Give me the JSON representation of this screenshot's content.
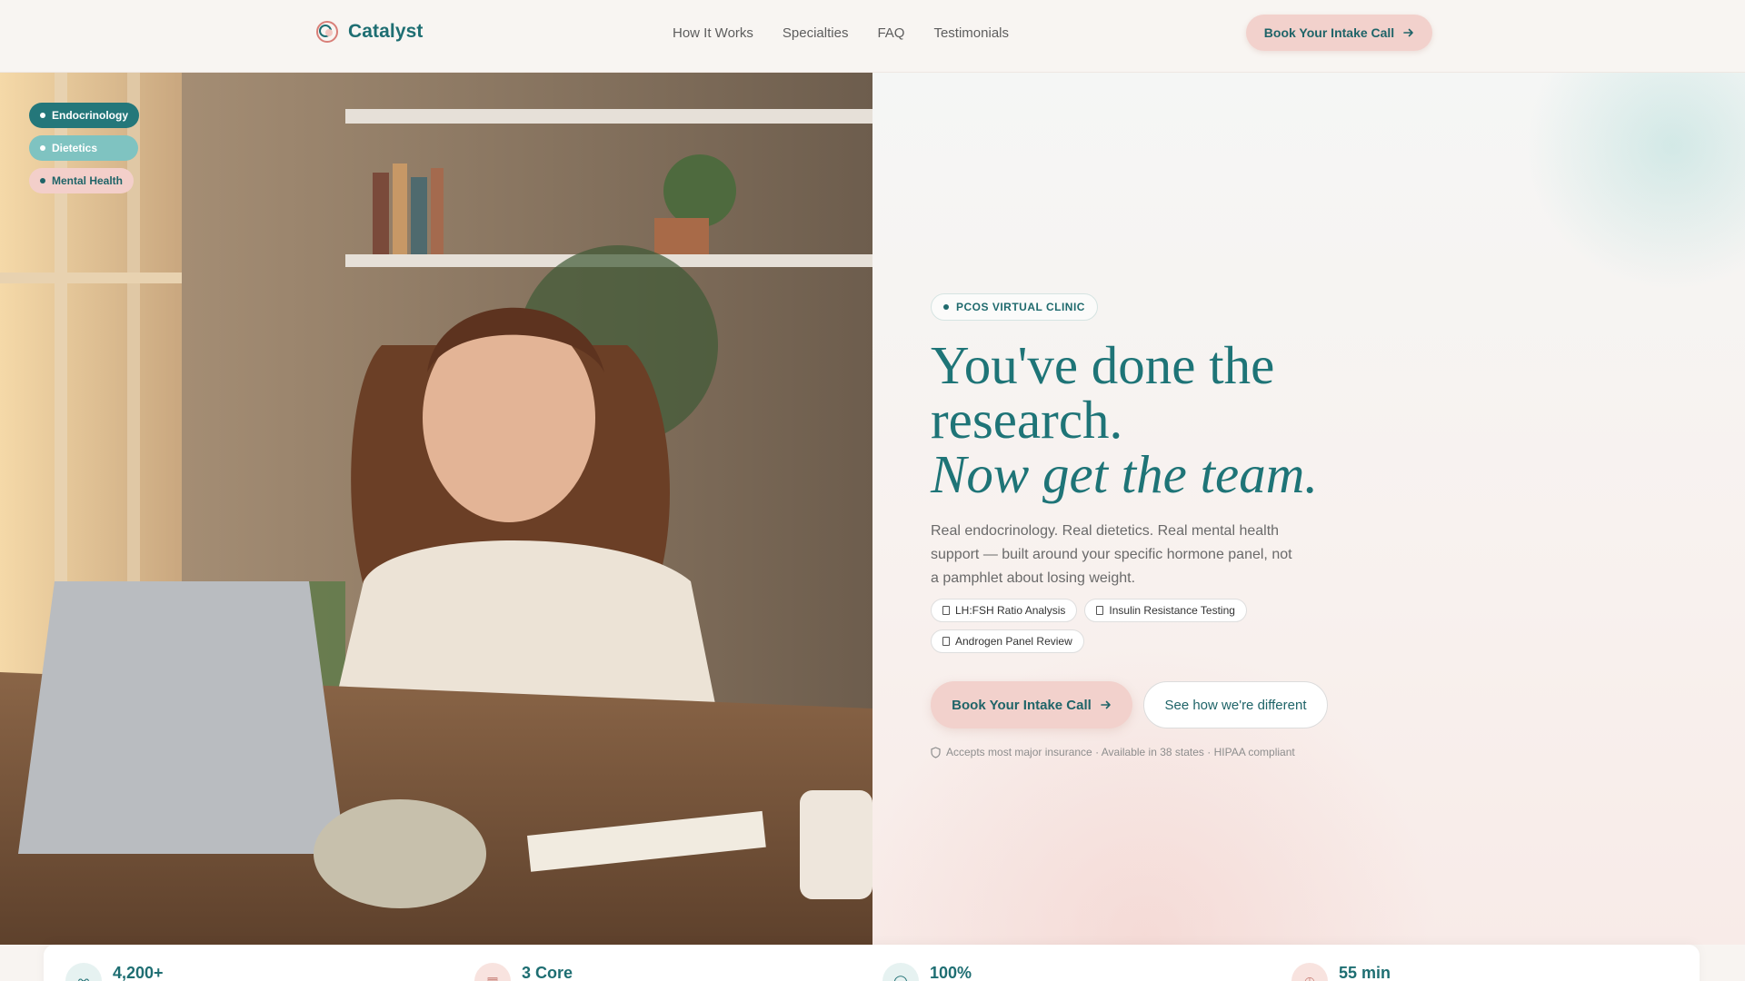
{
  "nav": {
    "brand": "Catalyst",
    "links": [
      "How It Works",
      "Specialties",
      "FAQ",
      "Testimonials"
    ],
    "cta_label": "Book Your Intake Call"
  },
  "hero_chips": [
    {
      "label": "Endocrinology"
    },
    {
      "label": "Dietetics"
    },
    {
      "label": "Mental Health"
    }
  ],
  "hero": {
    "eyebrow": "PCOS VIRTUAL CLINIC",
    "headline_line1": "You've done the",
    "headline_line2": "research.",
    "headline_italic": "Now get the team.",
    "lede": "Real endocrinology. Real dietetics. Real mental health support — built around your specific hormone panel, not a pamphlet about losing weight.",
    "tags": [
      "LH:FSH Ratio Analysis",
      "Insulin Resistance Testing",
      "Androgen Panel Review"
    ],
    "primary_cta": "Book Your Intake Call",
    "secondary_cta": "See how we're different",
    "trust_line": "Accepts most major insurance · Available in 38 states · HIPAA compliant"
  },
  "stats": [
    {
      "value": "4,200+",
      "icon": "people-icon"
    },
    {
      "value": "3 Core",
      "icon": "calendar-icon"
    },
    {
      "value": "100%",
      "icon": "shield-icon"
    },
    {
      "value": "55 min",
      "icon": "clock-icon"
    }
  ],
  "colors": {
    "teal": "#1e7477",
    "blush": "#f2d1cc",
    "light_teal": "#7fc3c1",
    "background": "#f8f4f1"
  }
}
